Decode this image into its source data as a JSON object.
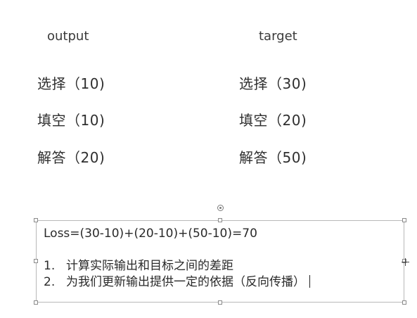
{
  "headers": {
    "output": "output",
    "target": "target"
  },
  "output_items": [
    "选择（10)",
    "填空（10)",
    "解答（20)"
  ],
  "target_items": [
    "选择（30)",
    "填空（20)",
    "解答（50)"
  ],
  "textbox": {
    "loss_line": "Loss=(30-10)+(20-10)+(50-10)=70",
    "list": [
      {
        "num": "1.",
        "text": "计算实际输出和目标之间的差距"
      },
      {
        "num": "2.",
        "text": "为我们更新输出提供一定的依据（反向传播）"
      }
    ]
  }
}
